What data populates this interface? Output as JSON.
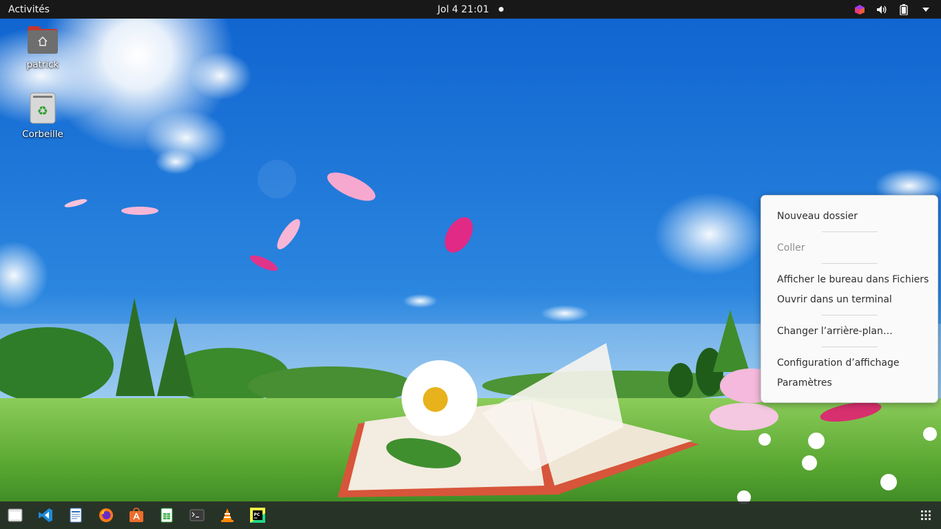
{
  "topbar": {
    "activities_label": "Activités",
    "clock": "Jol 4  21:01",
    "tray_icons": [
      "app-indicator-icon",
      "volume-icon",
      "battery-icon",
      "system-menu-arrow-icon"
    ]
  },
  "desktop": {
    "icons": [
      {
        "label": "patrick",
        "icon": "home-folder-icon"
      },
      {
        "label": "Corbeille",
        "icon": "trash-icon"
      }
    ]
  },
  "context_menu": {
    "new_folder": "Nouveau dossier",
    "paste": "Coller",
    "show_in_files": "Afficher le bureau dans Fichiers",
    "open_terminal": "Ouvrir dans un terminal",
    "change_background": "Changer l’arrière-plan…",
    "display_settings": "Configuration d’affichage",
    "settings": "Paramètres"
  },
  "dock": {
    "items": [
      "files-icon",
      "vscode-icon",
      "text-editor-icon",
      "firefox-icon",
      "software-center-icon",
      "spreadsheet-icon",
      "terminal-icon",
      "vlc-icon",
      "pycharm-icon"
    ],
    "apps_grid": "show-applications-icon"
  },
  "colors": {
    "topbar_bg": "#181818",
    "dock_bg": "#262828",
    "menu_bg": "#fafafa",
    "sky": "#1e74d2",
    "grass": "#5fae33"
  }
}
